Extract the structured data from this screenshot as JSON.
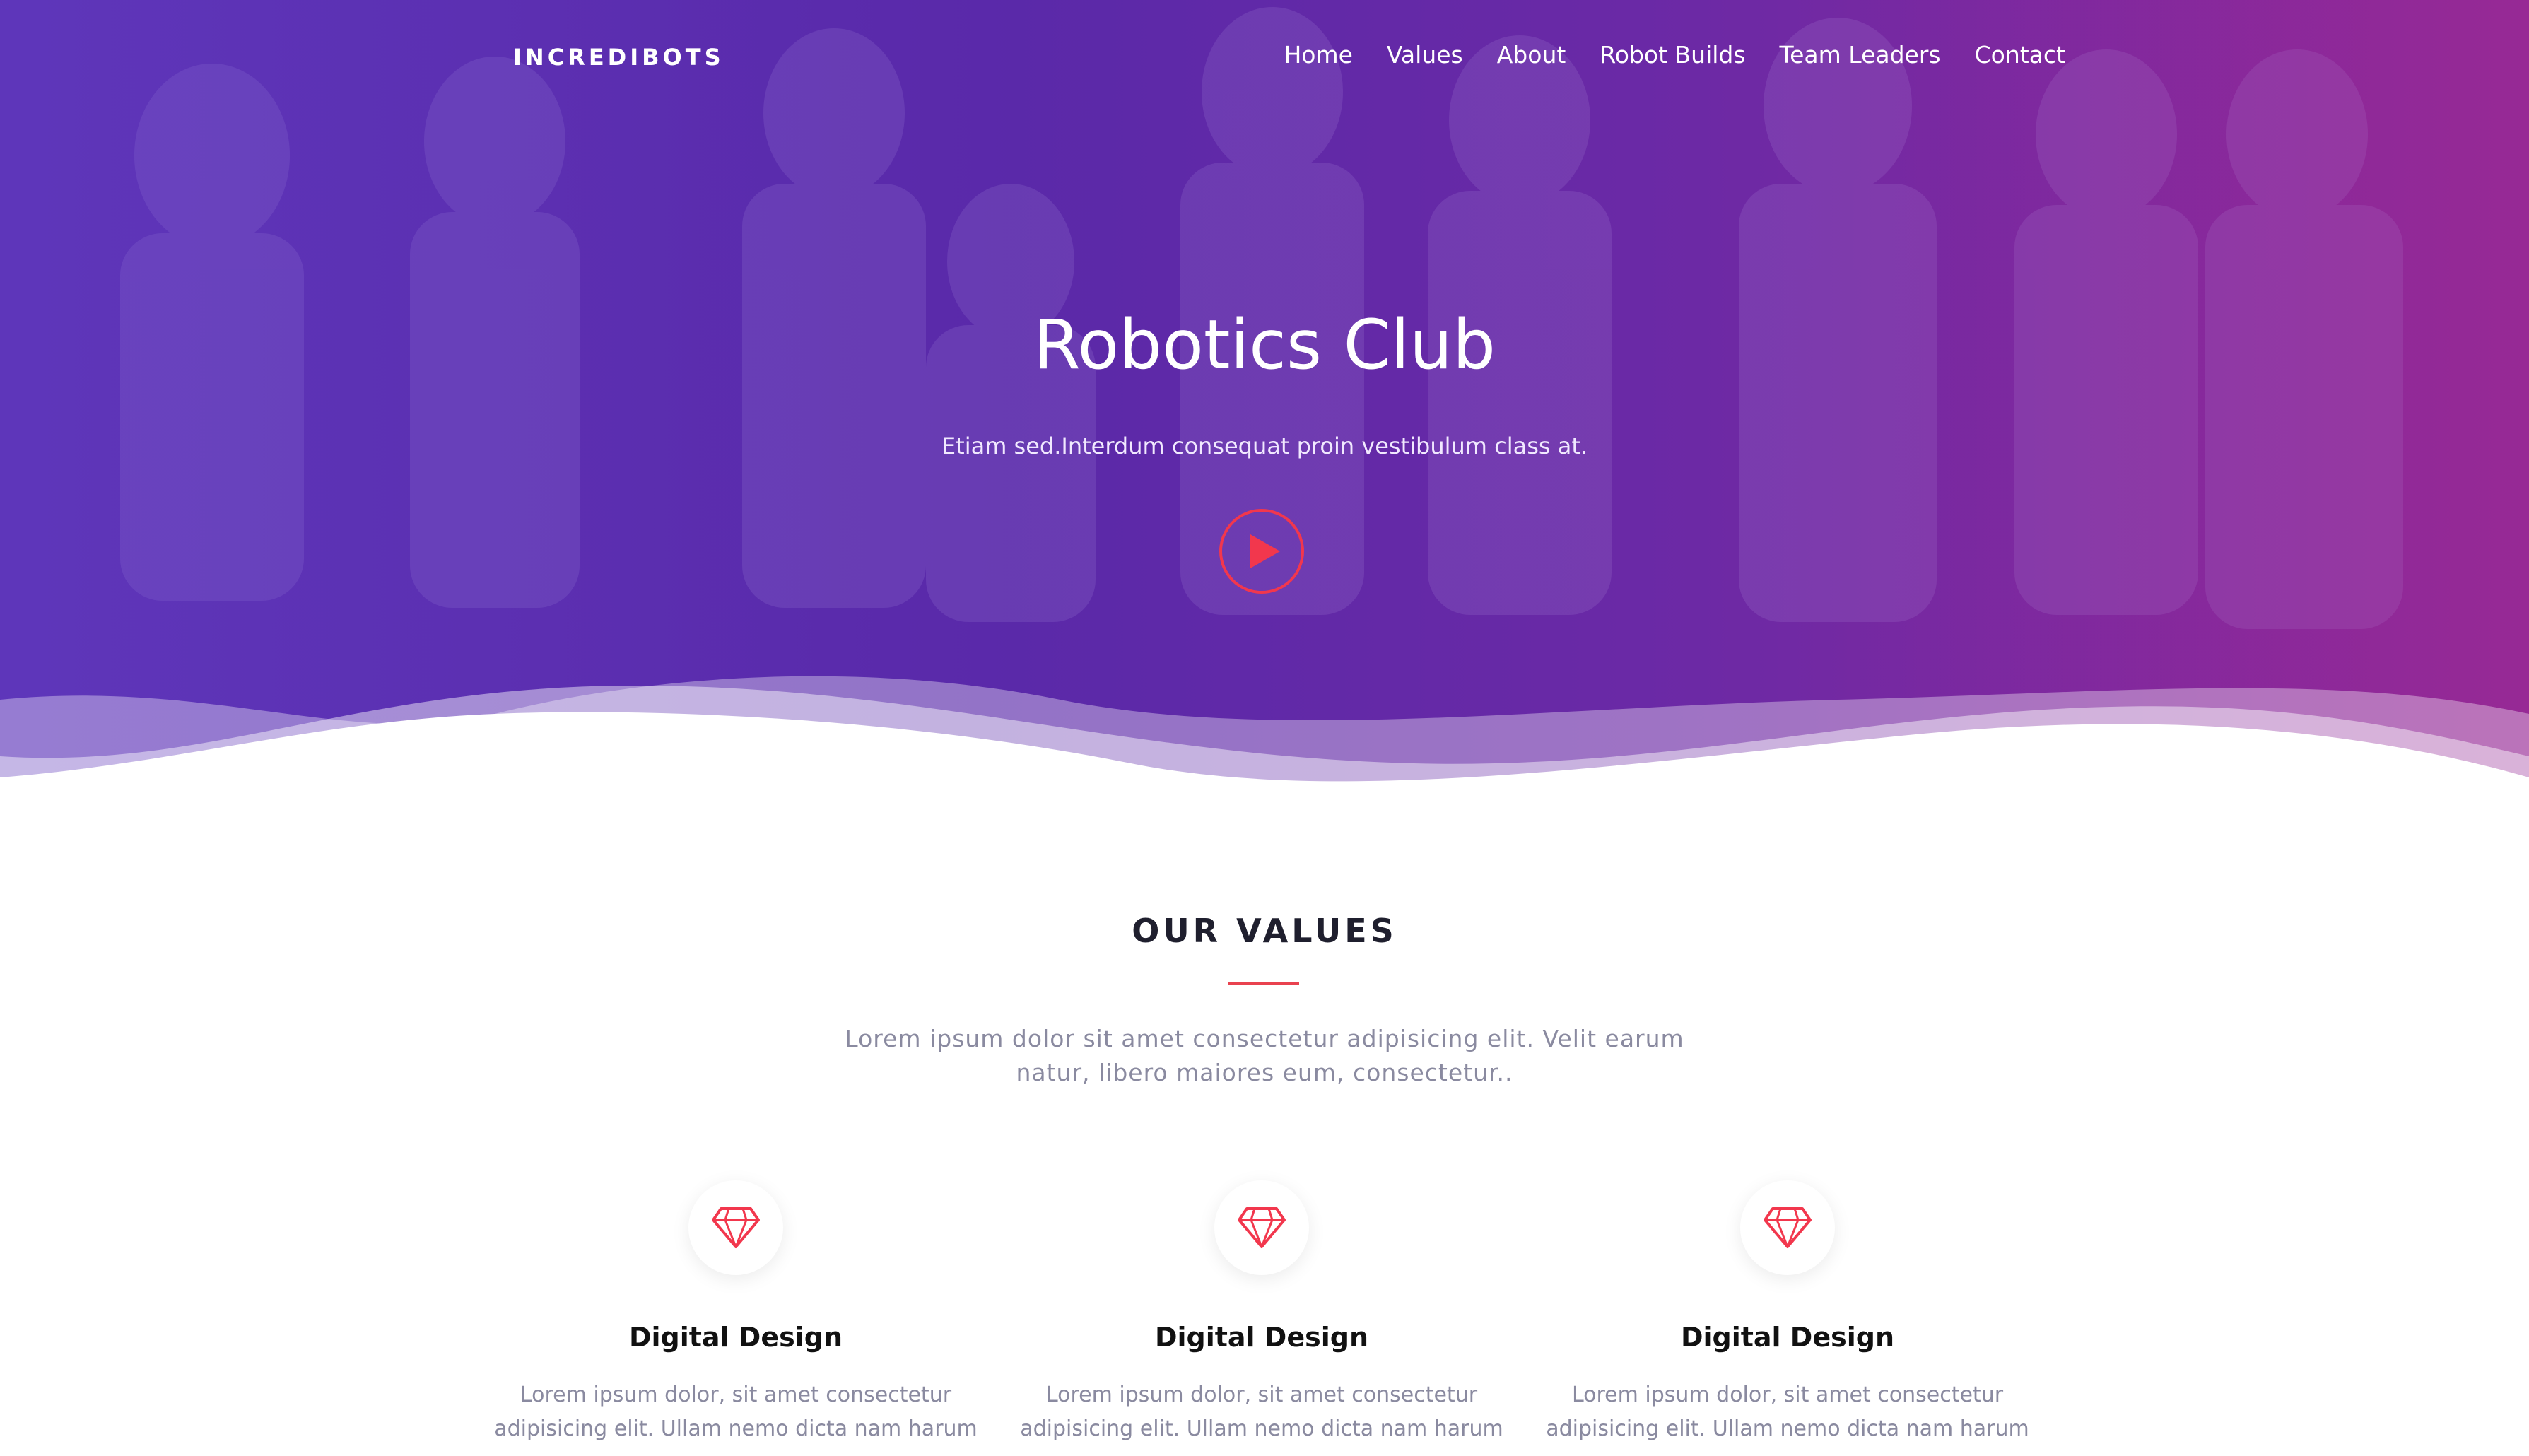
{
  "header": {
    "brand": "INCREDIBOTS",
    "nav": [
      "Home",
      "Values",
      "About",
      "Robot Builds",
      "Team Leaders",
      "Contact"
    ]
  },
  "hero": {
    "title": "Robotics Club",
    "subtitle": "Etiam sed.Interdum consequat proin vestibulum class at.",
    "play_icon": "play-icon"
  },
  "values": {
    "title": "OUR VALUES",
    "description": "Lorem ipsum dolor sit amet consectetur adipisicing elit. Velit earum natur, libero maiores eum, consectetur..",
    "cards": [
      {
        "icon": "diamond-icon",
        "title": "Digital Design",
        "text": "Lorem ipsum dolor, sit amet consectetur adipisicing elit. Ullam nemo dicta nam harum"
      },
      {
        "icon": "diamond-icon",
        "title": "Digital Design",
        "text": "Lorem ipsum dolor, sit amet consectetur adipisicing elit. Ullam nemo dicta nam harum"
      },
      {
        "icon": "diamond-icon",
        "title": "Digital Design",
        "text": "Lorem ipsum dolor, sit amet consectetur adipisicing elit. Ullam nemo dicta nam harum"
      }
    ]
  },
  "colors": {
    "accent": "#f2374d",
    "hero_purple": "#5b2aa8",
    "hero_magenta": "#9a2c92"
  }
}
